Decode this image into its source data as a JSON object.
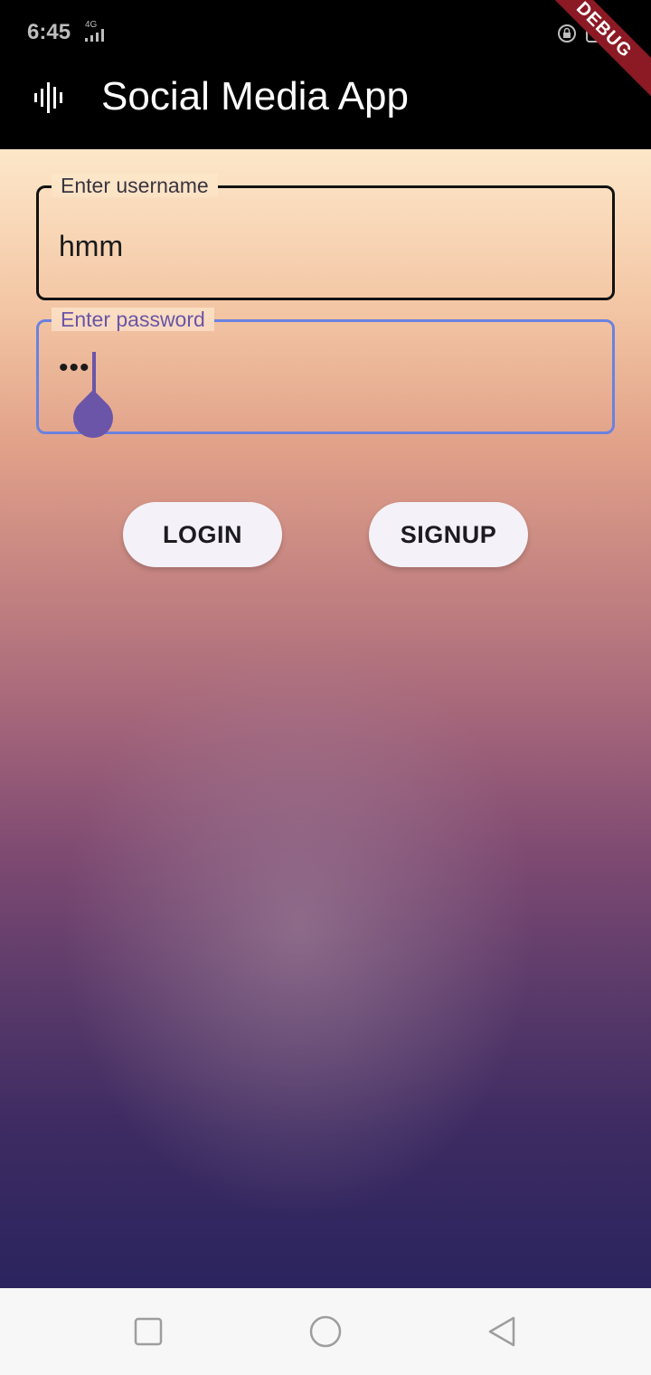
{
  "status_bar": {
    "time": "6:45",
    "network_label": "4G"
  },
  "debug_banner": {
    "label": "DEBUG",
    "color": "#8b1a24"
  },
  "app_bar": {
    "title": "Social Media App",
    "icon": "audio-waveform-icon"
  },
  "form": {
    "username": {
      "label": "Enter username",
      "value": "hmm"
    },
    "password": {
      "label": "Enter password",
      "value": "•••",
      "focused": true,
      "accent_color": "#6a82e0"
    }
  },
  "buttons": {
    "login_label": "LOGIN",
    "signup_label": "SIGNUP"
  },
  "nav_bar": {
    "recent_icon": "square-icon",
    "home_icon": "circle-icon",
    "back_icon": "triangle-back-icon"
  }
}
